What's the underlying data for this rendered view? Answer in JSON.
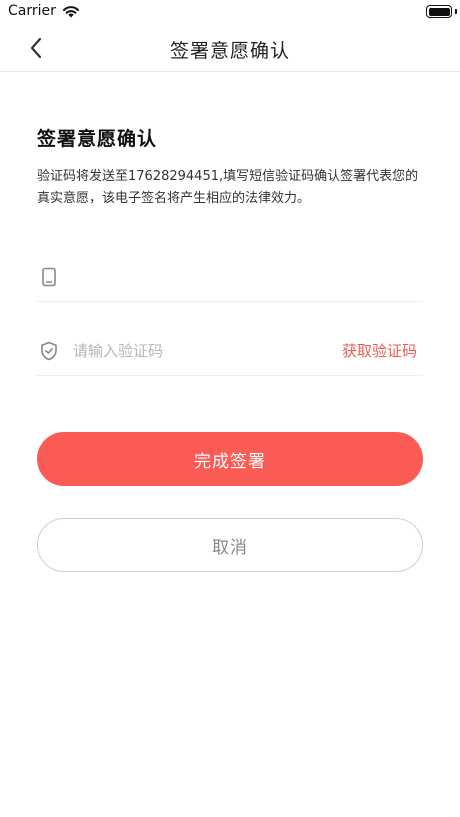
{
  "status_bar": {
    "carrier": "Carrier",
    "wifi_icon": "wifi-icon",
    "battery_icon": "battery-icon",
    "battery_level": 1.0
  },
  "nav": {
    "title": "签署意愿确认",
    "back_icon": "chevron-left-icon"
  },
  "content": {
    "heading": "签署意愿确认",
    "description": "验证码将发送至17628294451,填写短信验证码确认签署代表您的真实意愿，该电子签名将产生相应的法律效力。"
  },
  "phone_field": {
    "icon": "phone-icon",
    "value": "",
    "placeholder": ""
  },
  "code_field": {
    "icon": "shield-icon",
    "value": "",
    "placeholder": "请输入验证码",
    "get_code_label": "获取验证码"
  },
  "actions": {
    "confirm_label": "完成签署",
    "cancel_label": "取消"
  },
  "colors": {
    "accent": "#fa5b55",
    "link": "#f05a55",
    "divider": "#eeeeee",
    "placeholder": "#b5b5b5"
  }
}
